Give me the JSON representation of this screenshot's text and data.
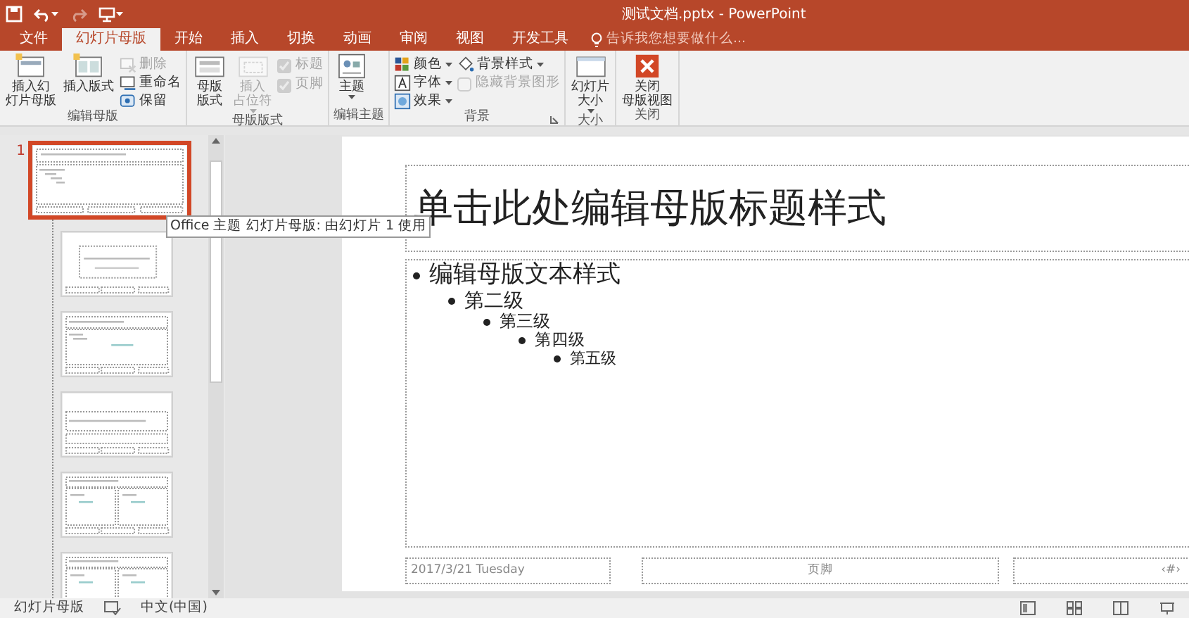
{
  "window": {
    "title": "测试文档.pptx - PowerPoint"
  },
  "quick_access": [
    {
      "kind": "save",
      "disabled": false
    },
    {
      "kind": "undo",
      "disabled": false
    },
    {
      "kind": "redo",
      "disabled": true
    },
    {
      "kind": "customize",
      "disabled": false
    }
  ],
  "tabs": [
    {
      "label": "文件",
      "selected": false
    },
    {
      "label": "幻灯片母版",
      "selected": true
    },
    {
      "label": "开始",
      "selected": false
    },
    {
      "label": "插入",
      "selected": false
    },
    {
      "label": "切换",
      "selected": false
    },
    {
      "label": "动画",
      "selected": false
    },
    {
      "label": "审阅",
      "selected": false
    },
    {
      "label": "视图",
      "selected": false
    },
    {
      "label": "开发工具",
      "selected": false
    }
  ],
  "tell_me": {
    "placeholder": "告诉我您想要做什么..."
  },
  "ribbon_groups": [
    {
      "label": "编辑母版",
      "items": [
        {
          "kind": "large",
          "lines": [
            "插入幻",
            "灯片母版"
          ],
          "disabled": false
        },
        {
          "kind": "large",
          "lines": [
            "插入版式"
          ],
          "disabled": false
        },
        {
          "kind": "small",
          "label": "删除",
          "disabled": true
        },
        {
          "kind": "small",
          "label": "重命名",
          "disabled": false
        },
        {
          "kind": "small",
          "label": "保留",
          "disabled": false
        }
      ]
    },
    {
      "label": "母版版式",
      "items": [
        {
          "kind": "large",
          "lines": [
            "母版",
            "版式"
          ],
          "disabled": false
        },
        {
          "kind": "large",
          "lines": [
            "插入",
            "占位符"
          ],
          "disabled": true,
          "dropdown": true
        },
        {
          "kind": "check",
          "label": "标题",
          "checked": true,
          "disabled": true
        },
        {
          "kind": "check",
          "label": "页脚",
          "checked": true,
          "disabled": true
        }
      ]
    },
    {
      "label": "编辑主题",
      "items": [
        {
          "kind": "large",
          "lines": [
            "主题"
          ],
          "disabled": false,
          "dropdown": true
        }
      ]
    },
    {
      "label": "背景",
      "launcher": true,
      "items": [
        {
          "kind": "small",
          "label": "颜色",
          "disabled": false,
          "dropdown": true
        },
        {
          "kind": "small",
          "label": "字体",
          "disabled": false,
          "dropdown": true
        },
        {
          "kind": "small",
          "label": "效果",
          "disabled": false,
          "dropdown": true
        },
        {
          "kind": "small",
          "label": "背景样式",
          "disabled": false,
          "dropdown": true
        },
        {
          "kind": "check",
          "label": "隐藏背景图形",
          "checked": false,
          "disabled": true
        }
      ]
    },
    {
      "label": "大小",
      "items": [
        {
          "kind": "large",
          "lines": [
            "幻灯片",
            "大小"
          ],
          "disabled": false,
          "dropdown": true
        }
      ]
    },
    {
      "label": "关闭",
      "items": [
        {
          "kind": "large",
          "lines": [
            "关闭",
            "母版视图"
          ],
          "disabled": false
        }
      ]
    }
  ],
  "slide_pane": {
    "thumbnails": [
      {
        "number": "1",
        "kind": "master",
        "selected": true
      },
      {
        "kind": "title",
        "selected": false
      },
      {
        "kind": "content",
        "selected": false
      },
      {
        "kind": "section",
        "selected": false
      },
      {
        "kind": "two",
        "selected": false
      },
      {
        "kind": "comparison",
        "selected": false
      }
    ],
    "tooltip": "Office 主题 幻灯片母版: 由幻灯片 1 使用"
  },
  "slide": {
    "title": "单击此处编辑母版标题样式",
    "body": [
      {
        "text": "编辑母版文本样式",
        "children": [
          {
            "text": "第二级",
            "children": [
              {
                "text": "第三级",
                "children": [
                  {
                    "text": "第四级",
                    "children": [
                      {
                        "text": "第五级"
                      }
                    ]
                  }
                ]
              }
            ]
          }
        ]
      }
    ],
    "date": "2017/3/21 Tuesday",
    "footer": "页脚",
    "number": "‹#›"
  },
  "status_bar": {
    "view": "幻灯片母版",
    "language": "中文(中国)"
  }
}
